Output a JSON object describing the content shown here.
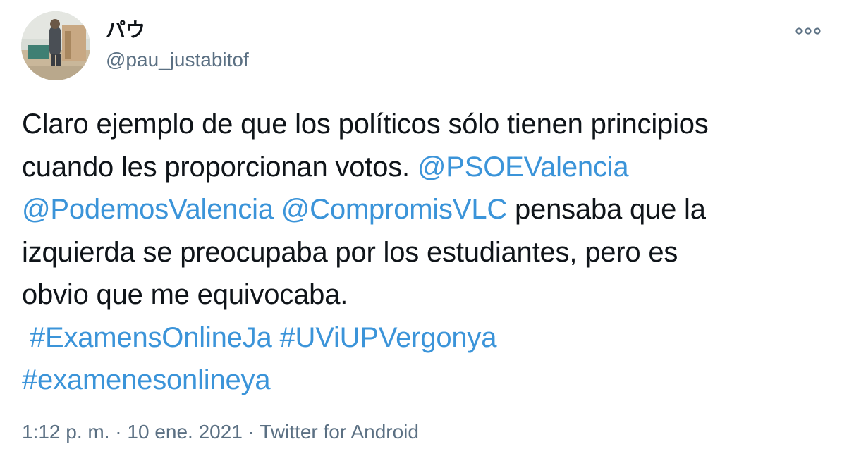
{
  "author": {
    "display_name": "パウ",
    "handle": "@pau_justabitof"
  },
  "more_icon": "more-horizontal-icon",
  "tweet": {
    "line1": {
      "t1": "Claro ejemplo de que los políticos sólo tienen principios"
    },
    "line2": {
      "t1": "cuando les proporcionan votos. ",
      "m1": "@PSOEValencia"
    },
    "line3": {
      "m1": "@PodemosValencia",
      "t1": " ",
      "m2": "@CompromisVLC",
      "t2": " pensaba que la"
    },
    "line4": {
      "t1": "izquierda se preocupaba por los estudiantes, pero es"
    },
    "line5": {
      "t1": "obvio que me equivocaba."
    },
    "line6": {
      "t1": " ",
      "h1": "#ExamensOnlineJa",
      "t2": " ",
      "h2": "#UViUPVergonya"
    },
    "line7": {
      "h1": "#examenesonlineya"
    }
  },
  "meta": {
    "time": "1:12 p. m.",
    "sep1": " · ",
    "date": "10 ene. 2021",
    "sep2": " · ",
    "source": "Twitter for Android"
  },
  "colors": {
    "link": "#3b94d9",
    "secondary_text": "#5b7083",
    "primary_text": "#0f1419"
  }
}
